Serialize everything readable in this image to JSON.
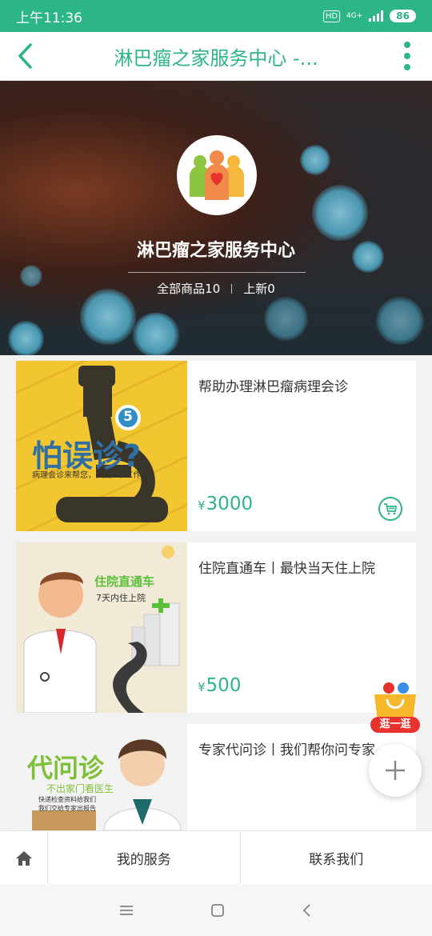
{
  "status_bar": {
    "time": "上午11:36",
    "hd": "HD",
    "network": "4G+",
    "battery": "86"
  },
  "header": {
    "title": "淋巴瘤之家服务中心 -...",
    "back_icon": "chevron-left-icon",
    "more_icon": "more-vertical-icon"
  },
  "shop": {
    "name": "淋巴瘤之家服务中心",
    "all_products": "全部商品10",
    "new_arrivals": "上新0"
  },
  "products": [
    {
      "title": "帮助办理淋巴瘤病理会诊",
      "price": "3000",
      "currency": "¥",
      "image_text": {
        "headline": "怕误诊?",
        "sub": "病理会诊来帮您，只需5个工作日",
        "badge": "5"
      }
    },
    {
      "title": "住院直通车丨最快当天住上院",
      "price": "500",
      "currency": "¥",
      "image_text": {
        "headline": "住院直通车",
        "sub": "7天内住上院"
      }
    },
    {
      "title": "专家代问诊丨我们帮你问专家",
      "image_text": {
        "headline": "代问诊",
        "sub": "不出家门看医生",
        "line1": "快递检查资料给我们",
        "line2": "我们交给专家出报告"
      }
    }
  ],
  "floating": {
    "shop_label": "逛一逛"
  },
  "bottom_tabs": {
    "home_icon": "home-icon",
    "my_service": "我的服务",
    "contact_us": "联系我们"
  },
  "colors": {
    "brand": "#2db58a",
    "card_yellow": "#f2c631",
    "card_beige": "#f1ead6"
  }
}
